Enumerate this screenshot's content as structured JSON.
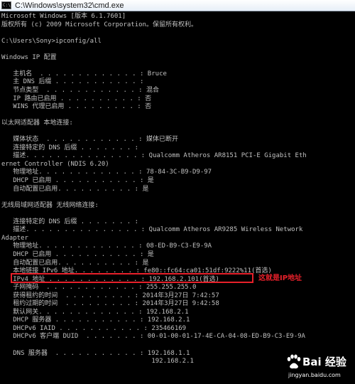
{
  "window": {
    "title": "C:\\Windows\\system32\\cmd.exe",
    "icon": "cmd-icon"
  },
  "console": {
    "lines": [
      "Microsoft Windows [版本 6.1.7601]",
      "版权所有 (c) 2009 Microsoft Corporation。保留所有权利。",
      "",
      "C:\\Users\\Sony>ipconfig/all",
      "",
      "Windows IP 配置",
      "",
      "   主机名  . . . . . . . . . . . . . : Bruce",
      "   主 DNS 后缀 . . . . . . . . . . . :",
      "   节点类型  . . . . . . . . . . . . : 混合",
      "   IP 路由已启用 . . . . . . . . . . : 否",
      "   WINS 代理已启用 . . . . . . . . . : 否",
      "",
      "以太网适配器 本地连接:",
      "",
      "   媒体状态  . . . . . . . . . . . . : 媒体已断开",
      "   连接特定的 DNS 后缀 . . . . . . . :",
      "   描述. . . . . . . . . . . . . . . : Qualcomm Atheros AR8151 PCI-E Gigabit Eth",
      "ernet Controller (NDIS 6.20)",
      "   物理地址. . . . . . . . . . . . . : 78-84-3C-B9-D9-97",
      "   DHCP 已启用 . . . . . . . . . . . : 是",
      "   自动配置已启用. . . . . . . . . . : 是",
      "",
      "无线局域网适配器 无线网络连接:",
      "",
      "   连接特定的 DNS 后缀 . . . . . . . :",
      "   描述. . . . . . . . . . . . . . . : Qualcomm Atheros AR9285 Wireless Network",
      "Adapter",
      "   物理地址. . . . . . . . . . . . . : 08-ED-B9-C3-E9-9A",
      "   DHCP 已启用 . . . . . . . . . . . : 是",
      "   自动配置已启用. . . . . . . . . . : 是",
      "   本地链接 IPv6 地址. . . . . . . . : fe80::fc64:ca01:51df:9222%11(首选)",
      "   IPv4 地址 . . . . . . . . . . . . : 192.168.2.101(首选)",
      "   子网掩码  . . . . . . . . . . . . : 255.255.255.0",
      "   获得租约的时间  . . . . . . . . . : 2014年3月27日 7:42:57",
      "   租约过期的时间  . . . . . . . . . : 2014年3月27日 9:42:58",
      "   默认网关. . . . . . . . . . . . . : 192.168.2.1",
      "   DHCP 服务器 . . . . . . . . . . . : 192.168.2.1",
      "   DHCPv6 IAID . . . . . . . . . . . : 235466169",
      "   DHCPv6 客户端 DUID  . . . . . . . : 00-01-00-01-17-4E-CA-04-08-ED-B9-C3-E9-9A",
      "",
      "   DNS 服务器  . . . . . . . . . . . : 192.168.1.1",
      "                                       192.168.2.1"
    ]
  },
  "annotation": {
    "label": "这就是IP地址",
    "color": "#e8202a"
  },
  "watermark": {
    "brand": "Bai 经验",
    "url": "jingyan.baidu.com",
    "icon": "baidu-paw-icon"
  },
  "colors": {
    "console_bg": "#000000",
    "console_text": "#c0c0c0",
    "highlight": "#e8202a"
  }
}
